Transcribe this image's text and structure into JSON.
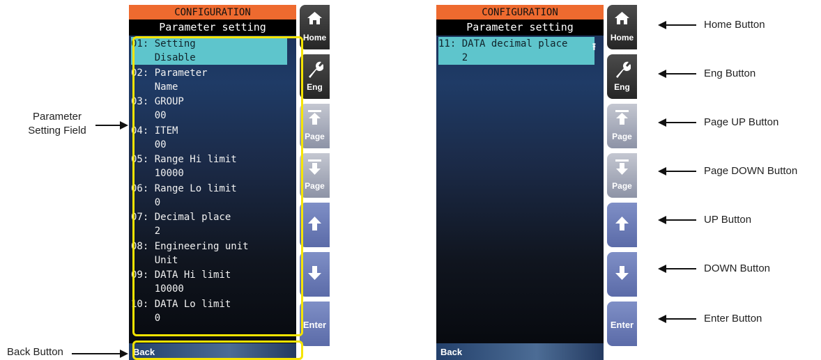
{
  "left_screen": {
    "title": "CONFIGURATION",
    "subtitle": "Parameter setting",
    "rows": [
      {
        "line1": "01: Setting",
        "line2": "    Disable"
      },
      {
        "line1": "02: Parameter",
        "line2": "    Name"
      },
      {
        "line1": "03: GROUP",
        "line2": "    00"
      },
      {
        "line1": "04: ITEM",
        "line2": "    00"
      },
      {
        "line1": "05: Range Hi limit",
        "line2": "    10000"
      },
      {
        "line1": "06: Range Lo limit",
        "line2": "    0"
      },
      {
        "line1": "07: Decimal place",
        "line2": "    2"
      },
      {
        "line1": "08: Engineering unit",
        "line2": "    Unit"
      },
      {
        "line1": "09: DATA Hi limit",
        "line2": "    10000"
      },
      {
        "line1": "10: DATA Lo limit",
        "line2": "    0"
      }
    ],
    "back_label": "Back"
  },
  "right_screen": {
    "title": "CONFIGURATION",
    "subtitle": "Parameter setting",
    "rows": [
      {
        "line1": "11: DATA decimal place",
        "line2": "    2"
      }
    ],
    "back_label": "Back"
  },
  "side_buttons": {
    "home": "Home",
    "eng": "Eng",
    "page_up": "Page",
    "page_down": "Page",
    "enter": "Enter"
  },
  "annotations": {
    "parameter_setting_field_1": "Parameter",
    "parameter_setting_field_2": "Setting Field",
    "back_button": "Back Button",
    "home_button": "Home Button",
    "eng_button": "Eng Button",
    "page_up_button": "Page UP Button",
    "page_down_button": "Page DOWN Button",
    "up_button": "UP Button",
    "down_button": "DOWN Button",
    "enter_button": "Enter Button"
  },
  "colors": {
    "title_orange": "#ee6a2f",
    "selected_row": "#5ec5cc",
    "highlight_yellow": "#f5e400"
  }
}
